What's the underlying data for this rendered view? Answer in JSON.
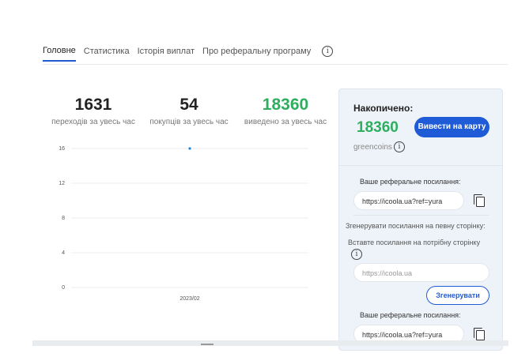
{
  "tabs": [
    {
      "label": "Головне",
      "active": true
    },
    {
      "label": "Статистика",
      "active": false
    },
    {
      "label": "Історія виплат",
      "active": false
    },
    {
      "label": "Про реферальну програму",
      "active": false
    }
  ],
  "tabs_info_icon": "info-icon",
  "stats": [
    {
      "value": "1631",
      "label": "переходів за увесь час",
      "color": "#222222"
    },
    {
      "value": "54",
      "label": "покупців за увесь час",
      "color": "#222222"
    },
    {
      "value": "18360",
      "label": "виведено за увесь час",
      "color": "#2fae5f"
    }
  ],
  "chart_data": {
    "type": "line",
    "x": [
      "2023/02"
    ],
    "series": [
      {
        "values": [
          16
        ]
      }
    ],
    "yticks": [
      0,
      4,
      8,
      12,
      16
    ],
    "ylim": [
      0,
      16
    ],
    "grid": true,
    "color": "#1e88e5"
  },
  "panel": {
    "accumulated_label": "Накопичено:",
    "amount": "18360",
    "currency": "greencoins",
    "withdraw_button": "Вивести на карту",
    "referral_label": "Ваше реферальне посилання:",
    "referral_link": "https://icoola.ua?ref=yura",
    "generate_heading": "Згенерувати посилання на певну сторінку:",
    "insert_label": "Вставте посилання на потрібну сторінку",
    "url_placeholder": "https://icoola.ua",
    "generate_button": "Згенерувати",
    "referral_label_2": "Ваше реферальне посилання:",
    "referral_link_2": "https://icoola.ua?ref=yura"
  },
  "colors": {
    "accent": "#1f5bd6",
    "green": "#2fae5f",
    "panel_bg": "#eef3f9"
  }
}
